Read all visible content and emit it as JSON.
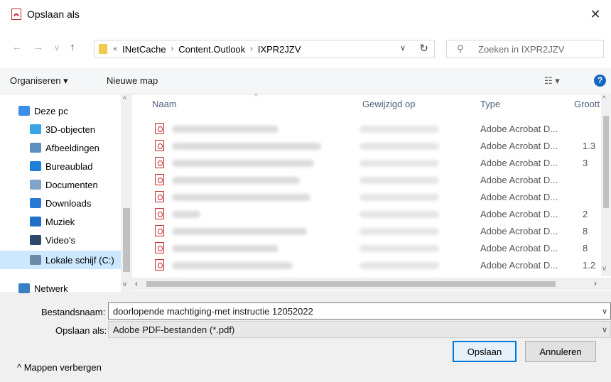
{
  "window": {
    "title": "Opslaan als",
    "close": "✕",
    "app_icon": "pdf-icon"
  },
  "nav": {
    "back": "←",
    "forward": "→",
    "recent": "∨",
    "up": "↑",
    "address": {
      "overflow": "«",
      "crumbs": [
        "INetCache",
        "Content.Outlook",
        "IXPR2JZV"
      ],
      "separator": "›",
      "dropdown": "∨",
      "refresh": "↻"
    },
    "search": {
      "placeholder": "Zoeken in IXPR2JZV",
      "icon": "⚲"
    }
  },
  "toolbar": {
    "organize": "Organiseren ▾",
    "new_folder": "Nieuwe map",
    "view": "☷ ▾",
    "help": "?"
  },
  "sidebar": {
    "items": [
      {
        "label": "Deze pc",
        "icon": "computer-icon",
        "color": "#3a8ee6"
      },
      {
        "label": "3D-objecten",
        "icon": "cube-icon",
        "color": "#3aa5e6"
      },
      {
        "label": "Afbeeldingen",
        "icon": "pictures-icon",
        "color": "#5f8fbf"
      },
      {
        "label": "Bureaublad",
        "icon": "desktop-icon",
        "color": "#1e7fd6"
      },
      {
        "label": "Documenten",
        "icon": "documents-icon",
        "color": "#7fa6c9"
      },
      {
        "label": "Downloads",
        "icon": "download-icon",
        "color": "#2a79d4"
      },
      {
        "label": "Muziek",
        "icon": "music-icon",
        "color": "#1f6fc4"
      },
      {
        "label": "Video's",
        "icon": "video-icon",
        "color": "#2b4a6b"
      },
      {
        "label": "Lokale schijf (C:)",
        "icon": "drive-icon",
        "color": "#6a8aa8",
        "selected": true
      },
      {
        "label": "Netwerk",
        "icon": "network-icon",
        "color": "#3a7fc4"
      }
    ]
  },
  "columns": {
    "name": "Naam",
    "modified": "Gewijzigd op",
    "type": "Type",
    "size": "Groott"
  },
  "rows": [
    {
      "type": "Adobe Acrobat D...",
      "size": ""
    },
    {
      "type": "Adobe Acrobat D...",
      "size": "1.3"
    },
    {
      "type": "Adobe Acrobat D...",
      "size": "3"
    },
    {
      "type": "Adobe Acrobat D...",
      "size": ""
    },
    {
      "type": "Adobe Acrobat D...",
      "size": ""
    },
    {
      "type": "Adobe Acrobat D...",
      "size": "2"
    },
    {
      "type": "Adobe Acrobat D...",
      "size": "8"
    },
    {
      "type": "Adobe Acrobat D...",
      "size": "8"
    },
    {
      "type": "Adobe Acrobat D...",
      "size": "1.2"
    }
  ],
  "form": {
    "filename_label": "Bestandsnaam:",
    "filename_value": "doorlopende machtiging-met instructie 12052022",
    "filetype_label": "Opslaan als:",
    "filetype_value": "Adobe PDF-bestanden (*.pdf)",
    "chevron": "∨"
  },
  "footer": {
    "toggle": "^ Mappen verbergen",
    "save": "Opslaan",
    "cancel": "Annuleren"
  },
  "colors": {
    "accent": "#0078d7",
    "selection": "#cce8ff",
    "pdf_red": "#c62828"
  }
}
